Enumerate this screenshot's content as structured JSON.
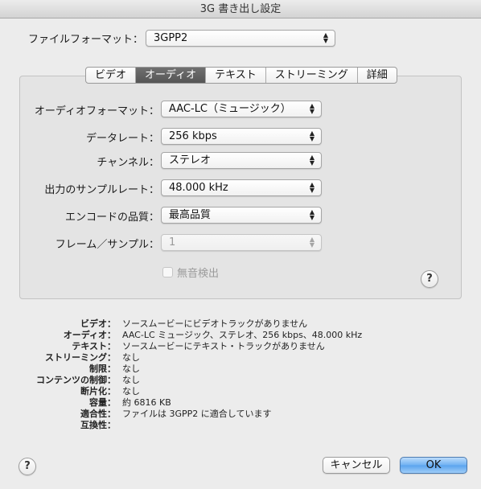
{
  "window": {
    "title": "3G 書き出し設定"
  },
  "file_format": {
    "label": "ファイルフォーマット：",
    "value": "3GPP2"
  },
  "tabs": [
    {
      "label": "ビデオ",
      "active": false
    },
    {
      "label": "オーディオ",
      "active": true
    },
    {
      "label": "テキスト",
      "active": false
    },
    {
      "label": "ストリーミング",
      "active": false
    },
    {
      "label": "詳細",
      "active": false
    }
  ],
  "audio": {
    "format": {
      "label": "オーディオフォーマット：",
      "value": "AAC-LC（ミュージック）"
    },
    "data_rate": {
      "label": "データレート：",
      "value": "256 kbps"
    },
    "channels": {
      "label": "チャンネル：",
      "value": "ステレオ"
    },
    "output_sample_rate": {
      "label": "出力のサンプルレート：",
      "value": "48.000 kHz"
    },
    "encode_quality": {
      "label": "エンコードの品質：",
      "value": "最高品質"
    },
    "frames_per_sample": {
      "label": "フレーム／サンプル：",
      "value": "1",
      "disabled": true
    },
    "silence_detect": {
      "label": "無音検出",
      "checked": false,
      "disabled": true
    }
  },
  "help_glyph": "?",
  "summary": [
    {
      "key": "ビデオ：",
      "value": "ソースムービーにビデオトラックがありません"
    },
    {
      "key": "オーディオ：",
      "value": "AAC-LC ミュージック、ステレオ、256 kbps、48.000 kHz"
    },
    {
      "key": "テキスト：",
      "value": "ソースムービーにテキスト・トラックがありません"
    },
    {
      "key": "ストリーミング：",
      "value": "なし"
    },
    {
      "key": "制限：",
      "value": "なし"
    },
    {
      "key": "コンテンツの制御：",
      "value": "なし"
    },
    {
      "key": "断片化：",
      "value": "なし"
    },
    {
      "key": "容量：",
      "value": "約 6816 KB"
    },
    {
      "key": "適合性：",
      "value": "ファイルは 3GPP2 に適合しています"
    },
    {
      "key": "互換性：",
      "value": ""
    }
  ],
  "buttons": {
    "cancel": "キャンセル",
    "ok": "OK"
  },
  "icons": {
    "popup_arrows": "updown-chevron-icon",
    "help": "help-icon"
  },
  "colors": {
    "default_button": "#5aa3ee",
    "active_tab": "#5f5f5f"
  }
}
